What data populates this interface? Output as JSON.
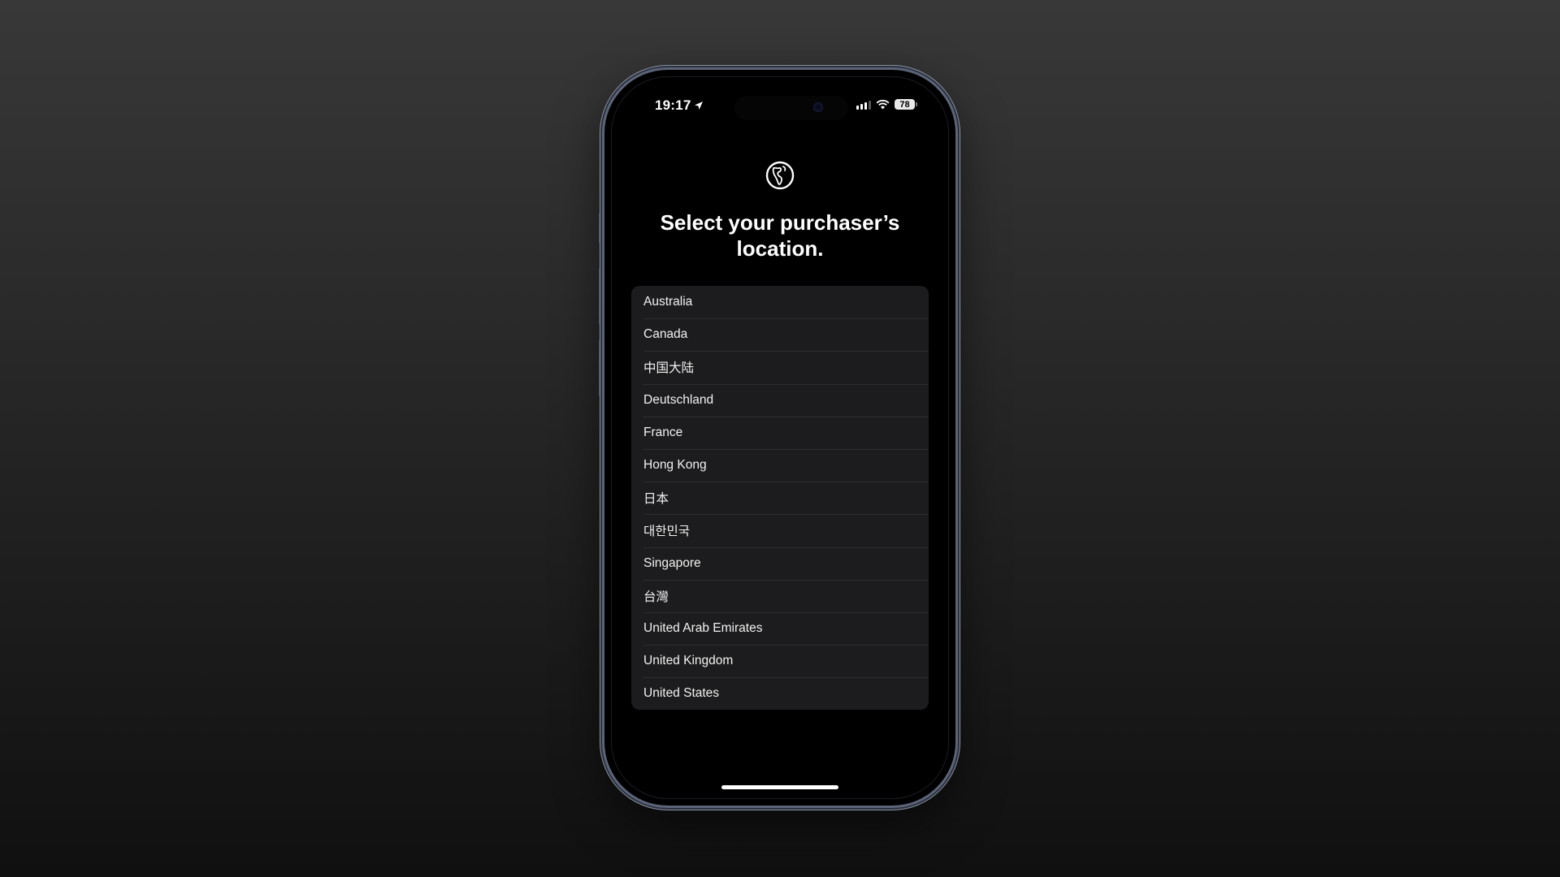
{
  "status_bar": {
    "time": "19:17",
    "location_icon": "location-arrow-icon",
    "signal_icon": "cellular-signal-icon",
    "wifi_icon": "wifi-icon",
    "battery_level": "78"
  },
  "header": {
    "icon": "globe-americas-icon",
    "title": "Select your purchaser’s location."
  },
  "locations": [
    {
      "label": "Australia"
    },
    {
      "label": "Canada"
    },
    {
      "label": "中国大陆"
    },
    {
      "label": "Deutschland"
    },
    {
      "label": "France"
    },
    {
      "label": "Hong Kong"
    },
    {
      "label": "日本"
    },
    {
      "label": "대한민국"
    },
    {
      "label": "Singapore"
    },
    {
      "label": "台灣"
    },
    {
      "label": "United Arab Emirates"
    },
    {
      "label": "United Kingdom"
    },
    {
      "label": "United States"
    }
  ]
}
